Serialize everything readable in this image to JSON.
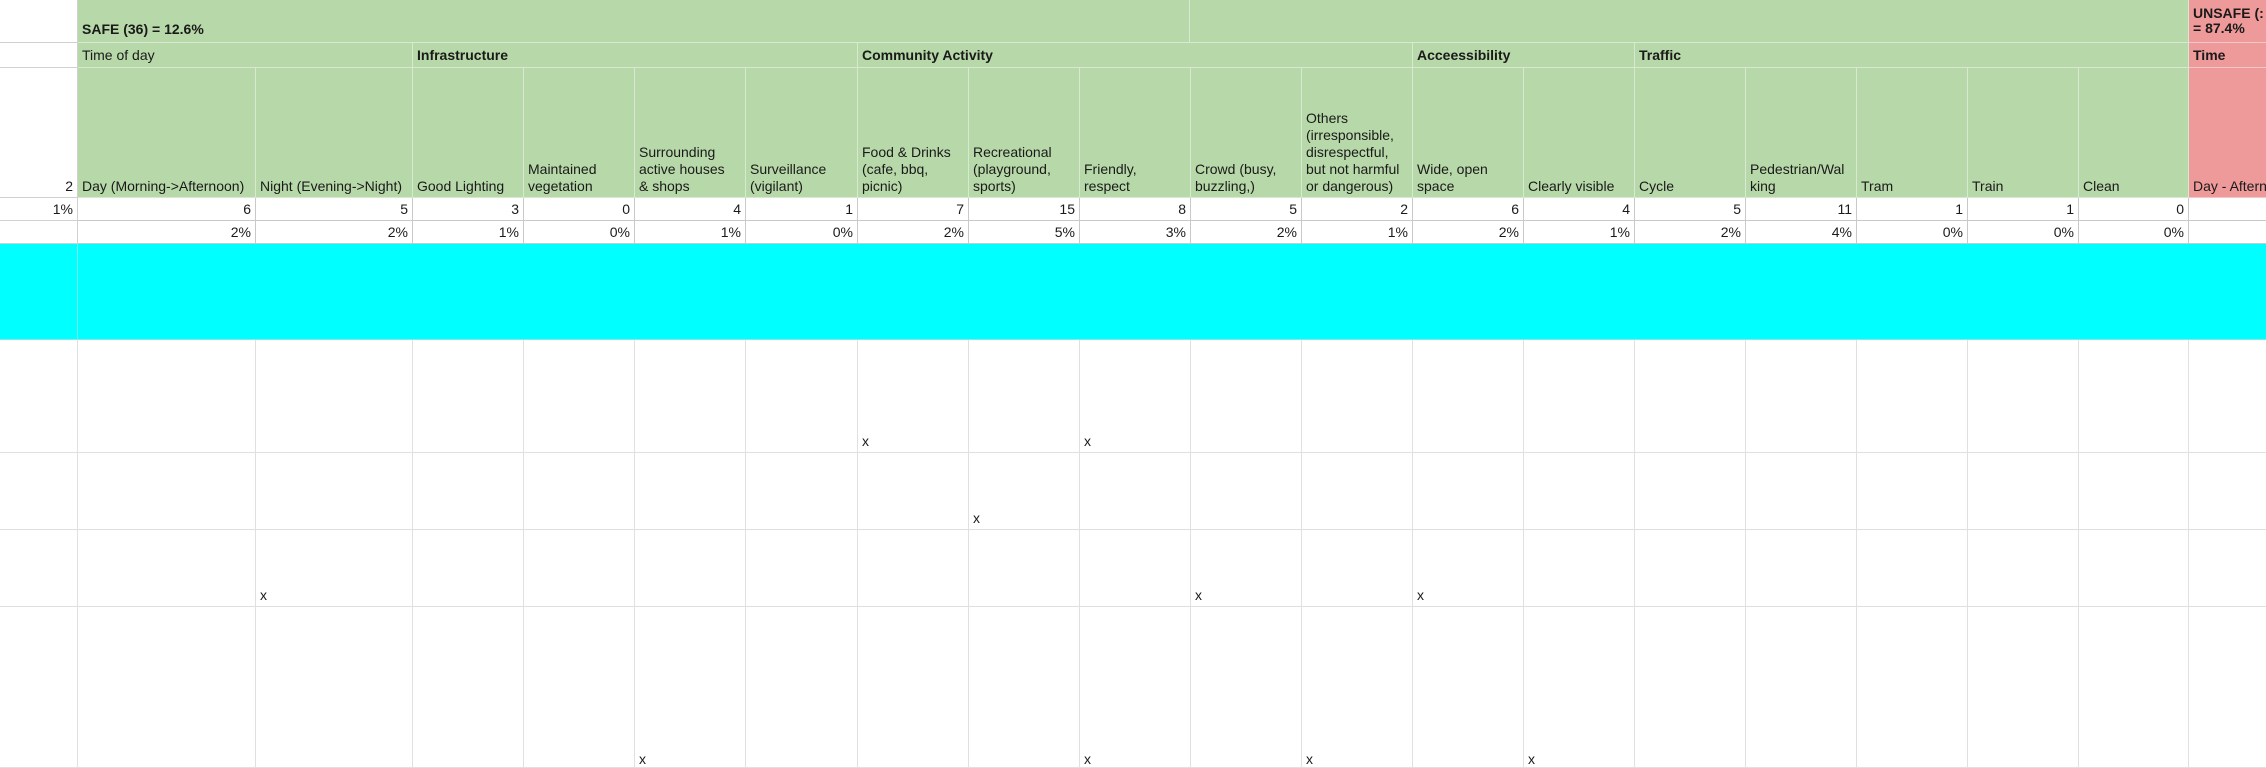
{
  "sheet": {
    "row1": {
      "safe_title": "SAFE (36) = 12.6%",
      "unsafe_title": "UNSAFE (:\n= 87.4%"
    },
    "row2": {
      "time_of_day": "Time of day",
      "infrastructure": "Infrastructure",
      "community_activity": "Community Activity",
      "accessibility": "Acceessibility",
      "traffic": "Traffic",
      "time": "Time"
    },
    "row3": {
      "row_number": "2",
      "columns": [
        "Day (Morning->Afternoon)",
        "Night (Evening->Night)",
        "Good Lighting",
        "Maintained\nvegetation",
        "Surrounding\nactive houses\n& shops",
        "Surveillance\n(vigilant)",
        "Food & Drinks\n(cafe, bbq,\npicnic)",
        "Recreational\n(playground,\nsports)",
        "Friendly, respect",
        "Crowd (busy,\nbuzzling,)",
        "Others\n(irresponsible,\ndisrespectful,\nbut not harmful\nor dangerous)",
        "Wide, open\nspace",
        "Clearly visible",
        "Cycle",
        "Pedestrian/Wal\nking",
        "Tram",
        "Train",
        "Clean",
        "Day - Aftern"
      ]
    },
    "row4": {
      "first": "1%",
      "counts": [
        "6",
        "5",
        "3",
        "0",
        "4",
        "1",
        "7",
        "15",
        "8",
        "5",
        "2",
        "6",
        "4",
        "5",
        "11",
        "1",
        "1",
        "0",
        ""
      ]
    },
    "row5": {
      "percents": [
        "2%",
        "2%",
        "1%",
        "0%",
        "1%",
        "0%",
        "2%",
        "5%",
        "3%",
        "2%",
        "1%",
        "2%",
        "1%",
        "2%",
        "4%",
        "0%",
        "0%",
        "0%",
        ""
      ]
    },
    "marks": {
      "a": "x",
      "b": "x",
      "c": "x",
      "d": "x",
      "e": "x",
      "f": "x",
      "g": "x",
      "h": "x",
      "i": "x",
      "j": "x",
      "k": "x"
    }
  }
}
